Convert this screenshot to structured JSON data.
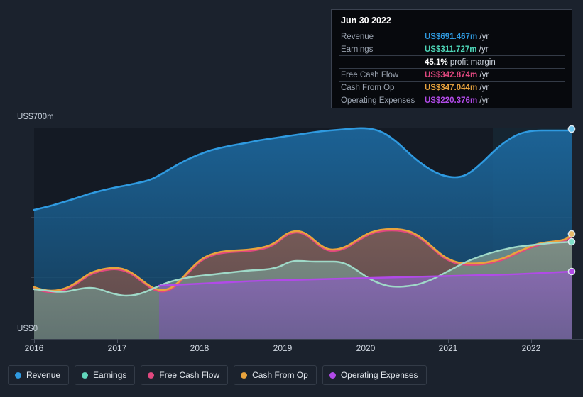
{
  "axis": {
    "y_top_label": "US$700m",
    "y_zero_label": "US$0",
    "x_ticks": [
      "2016",
      "2017",
      "2018",
      "2019",
      "2020",
      "2021",
      "2022"
    ]
  },
  "tooltip": {
    "date": "Jun 30 2022",
    "rows": [
      {
        "key": "Revenue",
        "value": "US$691.467m",
        "unit": "/yr",
        "color": "#2f9ae0"
      },
      {
        "key": "Earnings",
        "value": "US$311.727m",
        "unit": "/yr",
        "color": "#4ed6b8"
      },
      {
        "key": "Free Cash Flow",
        "value": "US$342.874m",
        "unit": "/yr",
        "color": "#e0487f"
      },
      {
        "key": "Cash From Op",
        "value": "US$347.044m",
        "unit": "/yr",
        "color": "#e8a33d"
      },
      {
        "key": "Operating Expenses",
        "value": "US$220.376m",
        "unit": "/yr",
        "color": "#b14ae8"
      }
    ],
    "profit_margin_value": "45.1%",
    "profit_margin_label": "profit margin"
  },
  "legend": [
    {
      "label": "Revenue",
      "color": "#2f9ae0"
    },
    {
      "label": "Earnings",
      "color": "#61d6bb"
    },
    {
      "label": "Free Cash Flow",
      "color": "#e0487f"
    },
    {
      "label": "Cash From Op",
      "color": "#e8a33d"
    },
    {
      "label": "Operating Expenses",
      "color": "#b14ae8"
    }
  ],
  "chart_data": {
    "type": "area",
    "title": "",
    "xlabel": "",
    "ylabel": "US$",
    "ylim": [
      0,
      700
    ],
    "xlim": [
      "2015-09-30",
      "2022-06-30"
    ],
    "grid": true,
    "gridlines_y": [
      0,
      200,
      400,
      600,
      700
    ],
    "legend_position": "bottom",
    "x": [
      "2015-09-30",
      "2015-12-31",
      "2016-03-31",
      "2016-06-30",
      "2016-09-30",
      "2016-12-31",
      "2017-03-31",
      "2017-06-30",
      "2017-09-30",
      "2017-12-31",
      "2018-03-31",
      "2018-06-30",
      "2018-09-30",
      "2018-12-31",
      "2019-03-31",
      "2019-06-30",
      "2019-09-30",
      "2019-12-31",
      "2020-03-31",
      "2020-06-30",
      "2020-09-30",
      "2020-12-31",
      "2021-03-31",
      "2021-06-30",
      "2021-09-30",
      "2021-12-31",
      "2022-03-31",
      "2022-06-30"
    ],
    "series": [
      {
        "name": "Revenue",
        "color": "#2f9ae0",
        "values": [
          428,
          437,
          448,
          458,
          470,
          478,
          483,
          492,
          516,
          538,
          551,
          562,
          574,
          586,
          594,
          600,
          606,
          614,
          626,
          632,
          620,
          594,
          566,
          552,
          560,
          601,
          645,
          691.467
        ]
      },
      {
        "name": "Earnings",
        "color": "#61d6bb",
        "values": [
          162,
          165,
          160,
          160,
          158,
          164,
          161,
          158,
          164,
          176,
          186,
          192,
          198,
          202,
          208,
          211,
          213,
          214,
          215,
          212,
          200,
          190,
          184,
          184,
          200,
          228,
          262,
          311.727
        ]
      },
      {
        "name": "Free Cash Flow",
        "color": "#e0487f",
        "values": [
          168,
          160,
          158,
          156,
          170,
          194,
          212,
          218,
          206,
          172,
          196,
          232,
          248,
          252,
          258,
          262,
          272,
          292,
          318,
          338,
          342,
          340,
          312,
          266,
          258,
          262,
          280,
          342.874
        ]
      },
      {
        "name": "Cash From Op",
        "color": "#e8a33d",
        "values": [
          172,
          163,
          160,
          159,
          174,
          198,
          216,
          222,
          210,
          176,
          200,
          236,
          252,
          256,
          262,
          266,
          276,
          296,
          322,
          342,
          346,
          344,
          316,
          270,
          262,
          266,
          284,
          347.044
        ]
      },
      {
        "name": "Operating Expenses",
        "color": "#b14ae8",
        "values": [
          null,
          null,
          null,
          null,
          null,
          null,
          null,
          176,
          178,
          180,
          182,
          184,
          186,
          188,
          190,
          192,
          194,
          196,
          198,
          200,
          202,
          203,
          204,
          206,
          208,
          212,
          216,
          220.376
        ]
      }
    ]
  }
}
